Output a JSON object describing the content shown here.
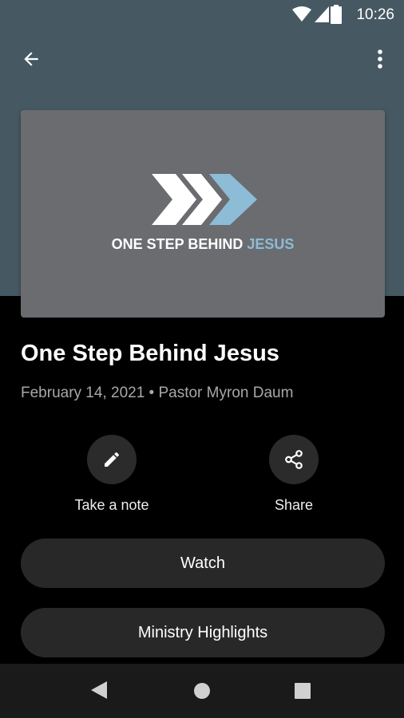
{
  "status_bar": {
    "time": "10:26"
  },
  "artwork": {
    "title_main": "ONE STEP BEHIND ",
    "title_accent": "JESUS"
  },
  "sermon": {
    "title": "One Step Behind Jesus",
    "meta": "February 14, 2021 • Pastor Myron Daum"
  },
  "actions": {
    "note_label": "Take a note",
    "share_label": "Share"
  },
  "buttons": {
    "watch_label": "Watch",
    "ministry_label": "Ministry Highlights"
  },
  "icons": {
    "back": "arrow-back-icon",
    "more": "more-vert-icon",
    "note": "pencil-icon",
    "share": "share-icon",
    "nav_back": "triangle-back-icon",
    "nav_home": "circle-home-icon",
    "nav_recents": "square-recents-icon"
  },
  "colors": {
    "header": "#465963",
    "accent": "#8dbcd6",
    "surface": "#282828",
    "background": "#000000"
  }
}
